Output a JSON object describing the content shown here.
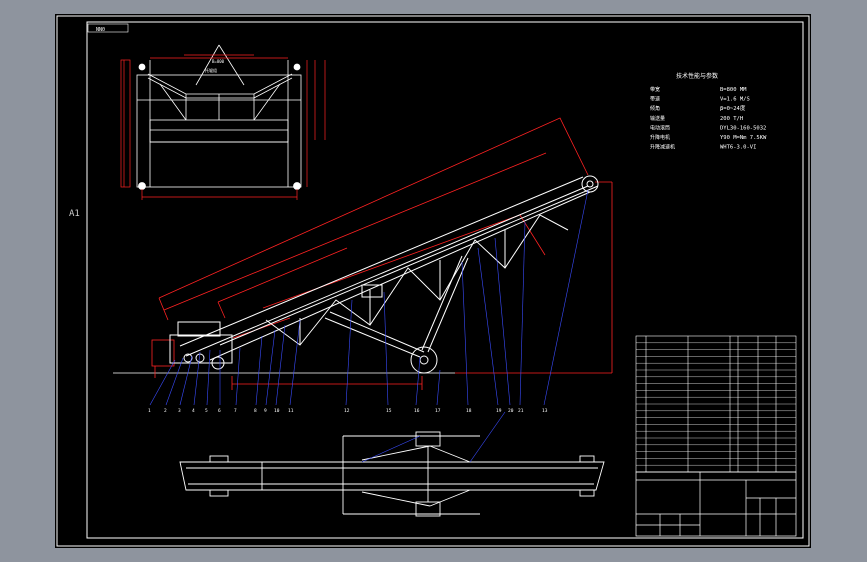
{
  "drawing": {
    "sheet_size_label": "A1",
    "top_left_tag": "NN0",
    "specs": {
      "heading": "技术性能与参数",
      "rows": [
        {
          "label": "带宽",
          "value": "B=800 MM"
        },
        {
          "label": "带速",
          "value": "V=1.6 M/S"
        },
        {
          "label": "倾角",
          "value": "β=0~24度"
        },
        {
          "label": "输送量",
          "value": "200 T/H"
        },
        {
          "label": "电动滚筒",
          "value": "DYL30-160-5032"
        },
        {
          "label": "升降电机",
          "value": "Y90 M=Nm 7.5KW"
        },
        {
          "label": "升降减速机",
          "value": "WHT6-3.0-VI"
        }
      ]
    },
    "cross_section": {
      "label_top": "B=800",
      "label_sub": "托辊组"
    },
    "balloons": [
      "1",
      "2",
      "3",
      "4",
      "5",
      "6",
      "7",
      "8",
      "9",
      "10",
      "11",
      "12",
      "13",
      "14",
      "15",
      "16",
      "17",
      "18",
      "19",
      "20",
      "21"
    ],
    "colors": {
      "background": "#000000",
      "frame": "#ffffff",
      "structure": "#ffffff",
      "dimension": "#ff2222",
      "leader": "#3a4cff",
      "outer": "#8e949e"
    }
  }
}
